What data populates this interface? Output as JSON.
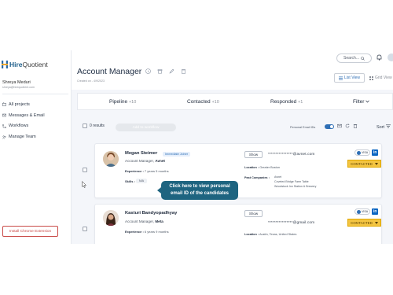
{
  "sidebar": {
    "brand_prefix": "Hire",
    "brand_suffix": "Quotient",
    "user_name": "Shreya Meduri",
    "user_email": "shreya@hirequotient.com",
    "nav": [
      {
        "label": "All projects",
        "icon": "folder-icon"
      },
      {
        "label": "Messages & Email",
        "icon": "mail-icon"
      },
      {
        "label": "Workflows",
        "icon": "workflow-icon"
      },
      {
        "label": "Manage Team",
        "icon": "team-icon"
      }
    ],
    "chrome_button": "Install Chrome Extension"
  },
  "header": {
    "title": "Account Manager",
    "created": "Created on - 4/9/2023",
    "search_label": "Search...",
    "view_list": "List View",
    "view_grid": "Grid View"
  },
  "stats": {
    "pipeline_label": "Pipeline",
    "pipeline_count": "+10",
    "contacted_label": "Contacted",
    "contacted_count": "+10",
    "responded_label": "Responded",
    "responded_count": "+1",
    "filter_label": "Filter"
  },
  "toolbar": {
    "results": "0 results",
    "add_button": "Add to workflow",
    "email_toggle_label": "Personal Email IDs",
    "sort_label": "Sort"
  },
  "tooltip": {
    "line1": "Click here to view personal",
    "line2": "email ID of the candidates"
  },
  "candidates": [
    {
      "name": "Megan Steimer",
      "badge": "Immediate Joiner",
      "role_prefix": "Account Manager,",
      "company": "Avnet",
      "experience_label": "Experience :",
      "experience": "7 years 5 months",
      "skills_label": "Skills :",
      "skill": "N/A",
      "show_label": "Show",
      "email": "****************@avnet.com",
      "location_label": "Location :",
      "location": "Greater Boston",
      "past_label": "Past Companies :",
      "past": [
        "Avnet",
        "Coveted Bridge Farm Table",
        "Woodstock Inn Station & Brewery"
      ],
      "visa": "VISA",
      "linkedin": "in",
      "status": "CONTACTED"
    },
    {
      "name": "Kasturi Bandyopadhyay",
      "role_prefix": "Account Manager,",
      "company": "Meta",
      "experience_label": "Experience :",
      "experience": "6 years 9 months",
      "show_label": "Show",
      "email": "****************@gmail.com",
      "location_label": "Location :",
      "location": "Austin, Texas, United States",
      "visa": "VISA",
      "linkedin": "in",
      "status": "CONTACTED"
    }
  ],
  "colors": {
    "accent": "#2f6fb5",
    "tooltip": "#1e6480",
    "contacted": "#f4c542",
    "danger": "#c94a47"
  }
}
